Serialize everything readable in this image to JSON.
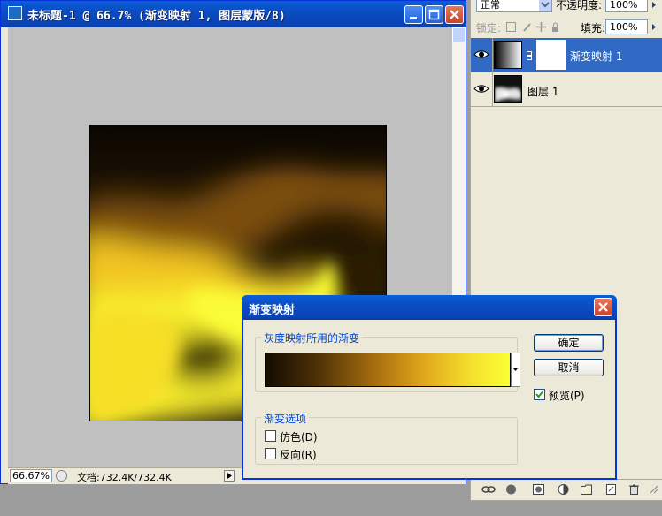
{
  "document_window": {
    "title": "未标题-1 @ 66.7% (渐变映射 1, 图层蒙版/8)",
    "zoom": "66.67%",
    "doc_info": "文档:732.4K/732.4K"
  },
  "layers_panel": {
    "blend_mode": "正常",
    "opacity_label": "不透明度:",
    "opacity_value": "100%",
    "lock_label": "锁定:",
    "fill_label": "填充:",
    "fill_value": "100%",
    "layers": [
      {
        "name": "渐变映射 1",
        "selected": true
      },
      {
        "name": "图层 1",
        "selected": false
      }
    ]
  },
  "dialog": {
    "title": "渐变映射",
    "gradient_group_label": "灰度映射所用的渐变",
    "options_group_label": "渐变选项",
    "dither_label": "仿色(D)",
    "dither_checked": false,
    "reverse_label": "反向(R)",
    "reverse_checked": false,
    "ok_label": "确定",
    "cancel_label": "取消",
    "preview_label": "预览(P)",
    "preview_checked": true
  },
  "colors": {
    "titlebar_blue": "#0a4cc2",
    "selected_layer": "#316ac5",
    "gradient_dark": "#140c02",
    "gradient_light": "#faff33"
  }
}
